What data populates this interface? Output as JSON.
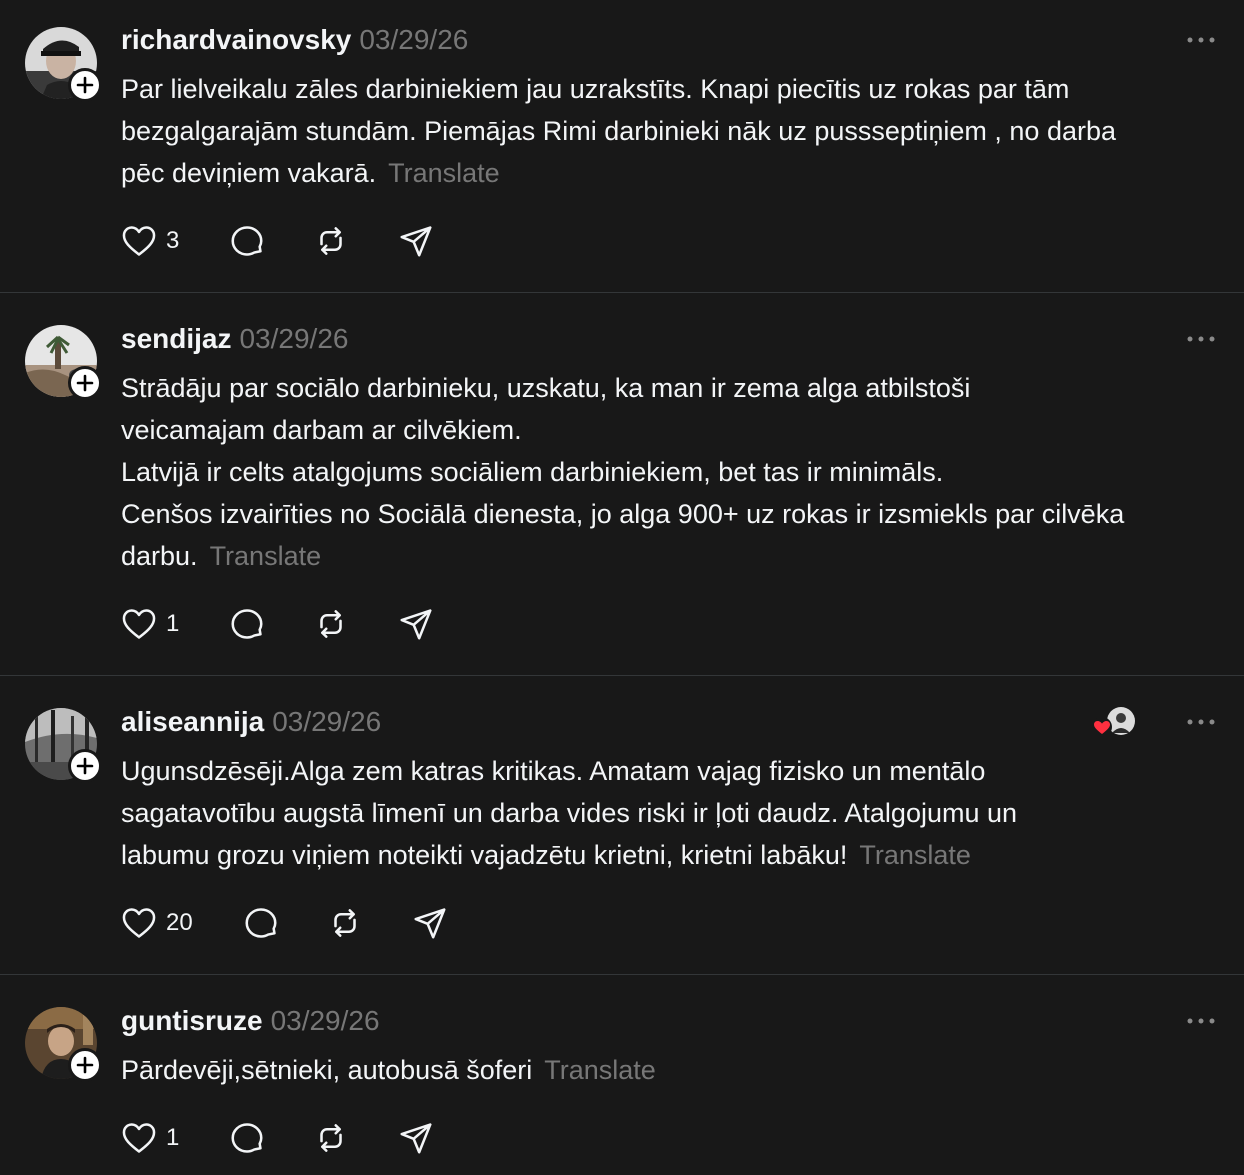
{
  "posts": [
    {
      "username": "richardvainovsky",
      "date": "03/29/26",
      "lines": [
        "Par lielveikalu zāles darbiniekiem jau uzrakstīts. Knapi piecītis uz rokas par tām",
        "bezgalgarajām stundām. Piemājas Rimi darbinieki nāk uz pussseptiņiem , no darba",
        "pēc deviņiem vakarā."
      ],
      "translate": "Translate",
      "likes": "3"
    },
    {
      "username": "sendijaz",
      "date": "03/29/26",
      "lines": [
        "Strādāju par sociālo darbinieku, uzskatu, ka man ir zema alga atbilstoši",
        "veicamajam darbam ar cilvēkiem.",
        "Latvijā ir celts atalgojums sociāliem darbiniekiem, bet tas ir minimāls.",
        "Cenšos izvairīties no Sociālā dienesta, jo alga 900+ uz rokas ir izsmiekls par cilvēka",
        "darbu."
      ],
      "translate": "Translate",
      "likes": "1"
    },
    {
      "username": "aliseannija",
      "date": "03/29/26",
      "lines": [
        "Ugunsdzēsēji.Alga zem katras kritikas. Amatam vajag fizisko un mentālo",
        "sagatavotību augstā līmenī un darba vides riski ir ļoti daudz. Atalgojumu un",
        "labumu grozu viņiem noteikti vajadzētu krietni, krietni labāku!"
      ],
      "translate": "Translate",
      "likes": "20"
    },
    {
      "username": "guntisruze",
      "date": "03/29/26",
      "lines": [
        "Pārdevēji,sētnieki, autobusā šoferi"
      ],
      "translate": "Translate",
      "likes": "1"
    }
  ],
  "icons": {
    "like": "heart-icon",
    "reply": "comment-icon",
    "repost": "repost-icon",
    "share": "send-icon",
    "more": "more-dots-icon",
    "follow": "plus-icon"
  },
  "colors": {
    "background": "#181818",
    "text": "#f3f5f7",
    "muted": "#777777",
    "divider": "#333638",
    "heart_badge": "#ff3040"
  }
}
